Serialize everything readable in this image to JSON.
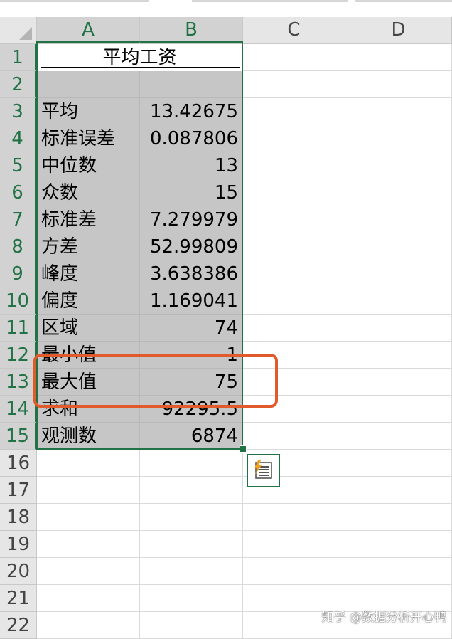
{
  "columns": [
    "A",
    "B",
    "C",
    "D"
  ],
  "rows": [
    "1",
    "2",
    "3",
    "4",
    "5",
    "6",
    "7",
    "8",
    "9",
    "10",
    "11",
    "12",
    "13",
    "14",
    "15",
    "16",
    "17",
    "18",
    "19",
    "20",
    "21",
    "22"
  ],
  "title": "平均工资",
  "stats": [
    {
      "label": "平均",
      "value": "13.42675"
    },
    {
      "label": "标准误差",
      "value": "0.087806"
    },
    {
      "label": "中位数",
      "value": "13"
    },
    {
      "label": "众数",
      "value": "15"
    },
    {
      "label": "标准差",
      "value": "7.279979"
    },
    {
      "label": "方差",
      "value": "52.99809"
    },
    {
      "label": "峰度",
      "value": "3.638386"
    },
    {
      "label": "偏度",
      "value": "1.169041"
    },
    {
      "label": "区域",
      "value": "74"
    },
    {
      "label": "最小值",
      "value": "1"
    },
    {
      "label": "最大值",
      "value": "75"
    },
    {
      "label": "求和",
      "value": "92295.5"
    },
    {
      "label": "观测数",
      "value": "6874"
    }
  ],
  "quick_analysis_icon": "quick-analysis-icon",
  "watermark": "知乎 @数据分析开心鸭",
  "colors": {
    "selection": "#217346",
    "highlight": "#e05a2b",
    "selected_fill": "#c6c6c6"
  }
}
